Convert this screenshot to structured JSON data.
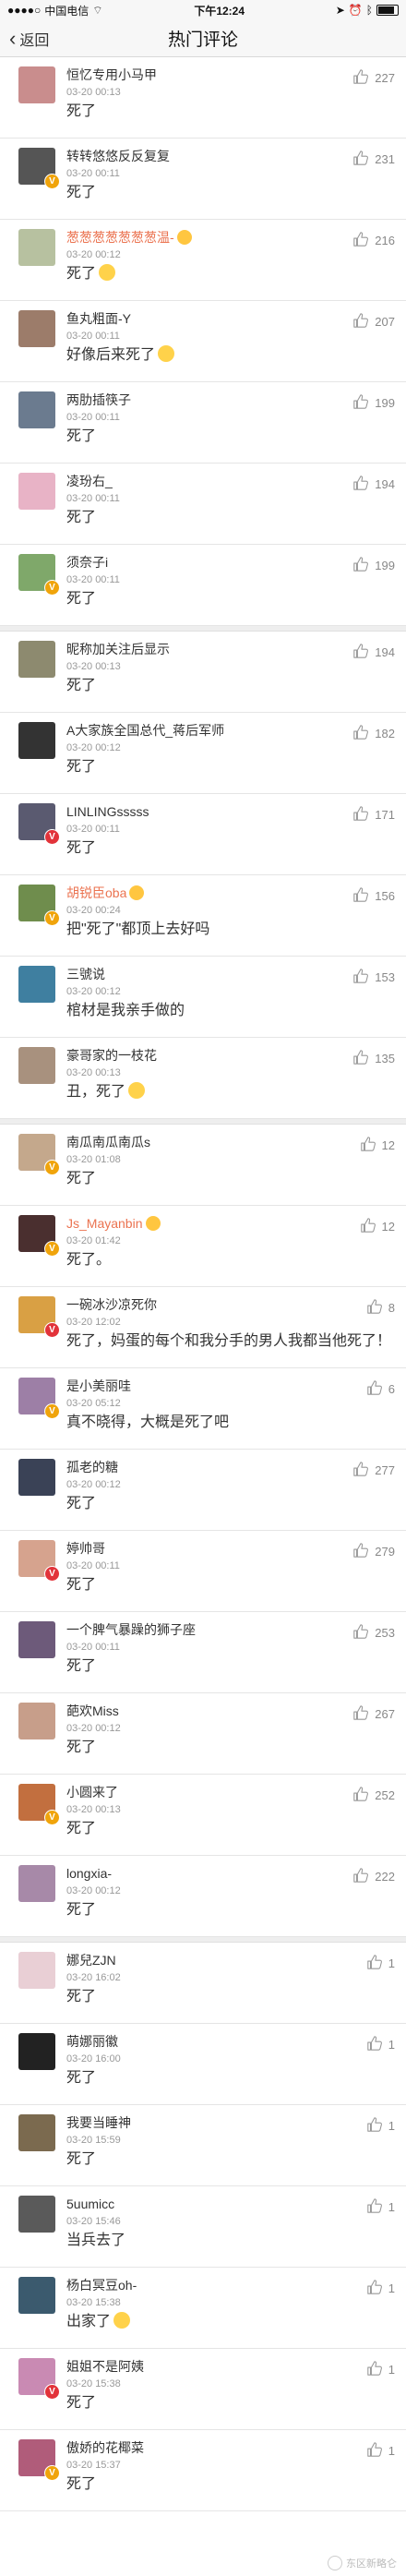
{
  "status": {
    "carrier": "中国电信",
    "time": "下午12:24"
  },
  "nav": {
    "back_label": "返回",
    "title": "热门评论"
  },
  "watermark": "东区新略仑",
  "comments": [
    {
      "user": "恒忆专用小马甲",
      "time": "03-20 00:13",
      "text": "死了",
      "likes": "227",
      "badge": "",
      "avatar_color": "#c98d8d",
      "name_color": "",
      "emoji_name": false,
      "emoji_text": false,
      "section_start": false
    },
    {
      "user": "转转悠悠反反复复",
      "time": "03-20 00:11",
      "text": "死了",
      "likes": "231",
      "badge": "yellow",
      "avatar_color": "#555555",
      "name_color": "",
      "emoji_name": false,
      "emoji_text": false,
      "section_start": false
    },
    {
      "user": "葱葱葱葱葱葱葱温-",
      "time": "03-20 00:12",
      "text": "死了",
      "likes": "216",
      "badge": "",
      "avatar_color": "#b7c1a0",
      "name_color": "orange",
      "emoji_name": true,
      "emoji_text": true,
      "section_start": false
    },
    {
      "user": "鱼丸粗面-Y",
      "time": "03-20 00:11",
      "text": "好像后来死了",
      "likes": "207",
      "badge": "",
      "avatar_color": "#9c7c6a",
      "name_color": "",
      "emoji_name": false,
      "emoji_text": true,
      "section_start": false
    },
    {
      "user": "两肋插筷子",
      "time": "03-20 00:11",
      "text": "死了",
      "likes": "199",
      "badge": "",
      "avatar_color": "#6b7b8f",
      "name_color": "",
      "emoji_name": false,
      "emoji_text": false,
      "section_start": false
    },
    {
      "user": "凌玢右_",
      "time": "03-20 00:11",
      "text": "死了",
      "likes": "194",
      "badge": "",
      "avatar_color": "#e8b3c6",
      "name_color": "",
      "emoji_name": false,
      "emoji_text": false,
      "section_start": false
    },
    {
      "user": "须奈子i",
      "time": "03-20 00:11",
      "text": "死了",
      "likes": "199",
      "badge": "yellow",
      "avatar_color": "#7fa86a",
      "name_color": "",
      "emoji_name": false,
      "emoji_text": false,
      "section_start": false
    },
    {
      "user": "昵称加关注后显示",
      "time": "03-20 00:13",
      "text": "死了",
      "likes": "194",
      "badge": "",
      "avatar_color": "#8d8a6f",
      "name_color": "",
      "emoji_name": false,
      "emoji_text": false,
      "section_start": true
    },
    {
      "user": "A大家族全国总代_蒋后军师",
      "time": "03-20 00:12",
      "text": "死了",
      "likes": "182",
      "badge": "",
      "avatar_color": "#333333",
      "name_color": "",
      "emoji_name": false,
      "emoji_text": false,
      "section_start": false
    },
    {
      "user": "LINLINGsssss",
      "time": "03-20 00:11",
      "text": "死了",
      "likes": "171",
      "badge": "red",
      "avatar_color": "#5a5a70",
      "name_color": "",
      "emoji_name": false,
      "emoji_text": false,
      "section_start": false
    },
    {
      "user": "胡锐臣oba",
      "time": "03-20 00:24",
      "text": "把\"死了\"都顶上去好吗",
      "likes": "156",
      "badge": "yellow",
      "avatar_color": "#6f8d4d",
      "name_color": "orange",
      "emoji_name": true,
      "emoji_text": false,
      "section_start": false
    },
    {
      "user": "三號说",
      "time": "03-20 00:12",
      "text": "棺材是我亲手做的",
      "likes": "153",
      "badge": "",
      "avatar_color": "#3f7fa0",
      "name_color": "",
      "emoji_name": false,
      "emoji_text": false,
      "section_start": false
    },
    {
      "user": "豪哥家的一枝花",
      "time": "03-20 00:13",
      "text": "丑，死了",
      "likes": "135",
      "badge": "",
      "avatar_color": "#a8917e",
      "name_color": "",
      "emoji_name": false,
      "emoji_text": true,
      "section_start": false
    },
    {
      "user": "南瓜南瓜南瓜s",
      "time": "03-20 01:08",
      "text": "死了",
      "likes": "12",
      "badge": "yellow",
      "avatar_color": "#c4a88c",
      "name_color": "",
      "emoji_name": false,
      "emoji_text": false,
      "section_start": true
    },
    {
      "user": "Js_Mayanbin",
      "time": "03-20 01:42",
      "text": "死了。",
      "likes": "12",
      "badge": "yellow",
      "avatar_color": "#4a2f2f",
      "name_color": "orange",
      "emoji_name": true,
      "emoji_text": false,
      "section_start": false
    },
    {
      "user": "一碗冰沙凉死你",
      "time": "03-20 12:02",
      "text": "死了，妈蛋的每个和我分手的男人我都当他死了！",
      "likes": "8",
      "badge": "red",
      "avatar_color": "#d9a044",
      "name_color": "",
      "emoji_name": false,
      "emoji_text": false,
      "section_start": false
    },
    {
      "user": "是小美丽哇",
      "time": "03-20 05:12",
      "text": "真不晓得，大概是死了吧",
      "likes": "6",
      "badge": "yellow",
      "avatar_color": "#9d7fa6",
      "name_color": "",
      "emoji_name": false,
      "emoji_text": false,
      "section_start": false
    },
    {
      "user": "孤老的糖",
      "time": "03-20 00:12",
      "text": "死了",
      "likes": "277",
      "badge": "",
      "avatar_color": "#3a4256",
      "name_color": "",
      "emoji_name": false,
      "emoji_text": false,
      "section_start": false
    },
    {
      "user": "婷帅哥",
      "time": "03-20 00:11",
      "text": "死了",
      "likes": "279",
      "badge": "red",
      "avatar_color": "#d6a38e",
      "name_color": "",
      "emoji_name": false,
      "emoji_text": false,
      "section_start": false
    },
    {
      "user": "一个脾气暴躁的狮子座",
      "time": "03-20 00:11",
      "text": "死了",
      "likes": "253",
      "badge": "",
      "avatar_color": "#6d5a7a",
      "name_color": "",
      "emoji_name": false,
      "emoji_text": false,
      "section_start": false
    },
    {
      "user": "葩欢Miss",
      "time": "03-20 00:12",
      "text": "死了",
      "likes": "267",
      "badge": "",
      "avatar_color": "#c79e8a",
      "name_color": "",
      "emoji_name": false,
      "emoji_text": false,
      "section_start": false
    },
    {
      "user": "小圆来了",
      "time": "03-20 00:13",
      "text": "死了",
      "likes": "252",
      "badge": "yellow",
      "avatar_color": "#c26f3f",
      "name_color": "",
      "emoji_name": false,
      "emoji_text": false,
      "section_start": false
    },
    {
      "user": "longxia-",
      "time": "03-20 00:12",
      "text": "死了",
      "likes": "222",
      "badge": "",
      "avatar_color": "#a789a8",
      "name_color": "",
      "emoji_name": false,
      "emoji_text": false,
      "section_start": false
    },
    {
      "user": "娜兒ZJN",
      "time": "03-20 16:02",
      "text": "死了",
      "likes": "1",
      "badge": "",
      "avatar_color": "#e9cfd5",
      "name_color": "",
      "emoji_name": false,
      "emoji_text": false,
      "section_start": true
    },
    {
      "user": "萌娜丽徽",
      "time": "03-20 16:00",
      "text": "死了",
      "likes": "1",
      "badge": "",
      "avatar_color": "#222222",
      "name_color": "",
      "emoji_name": false,
      "emoji_text": false,
      "section_start": false
    },
    {
      "user": "我要当睡神",
      "time": "03-20 15:59",
      "text": "死了",
      "likes": "1",
      "badge": "",
      "avatar_color": "#7b6a4f",
      "name_color": "",
      "emoji_name": false,
      "emoji_text": false,
      "section_start": false
    },
    {
      "user": "5uumicc",
      "time": "03-20 15:46",
      "text": "当兵去了",
      "likes": "1",
      "badge": "",
      "avatar_color": "#5a5a5a",
      "name_color": "",
      "emoji_name": false,
      "emoji_text": false,
      "section_start": false
    },
    {
      "user": "杨白冥豆oh-",
      "time": "03-20 15:38",
      "text": "出家了",
      "likes": "1",
      "badge": "",
      "avatar_color": "#3b5a6e",
      "name_color": "",
      "emoji_name": false,
      "emoji_text": true,
      "section_start": false
    },
    {
      "user": "姐姐不是阿姨",
      "time": "03-20 15:38",
      "text": "死了",
      "likes": "1",
      "badge": "red",
      "avatar_color": "#c98ab3",
      "name_color": "",
      "emoji_name": false,
      "emoji_text": false,
      "section_start": false
    },
    {
      "user": "傲娇的花椰菜",
      "time": "03-20 15:37",
      "text": "死了",
      "likes": "1",
      "badge": "yellow",
      "avatar_color": "#b05c7a",
      "name_color": "",
      "emoji_name": false,
      "emoji_text": false,
      "section_start": false
    }
  ]
}
